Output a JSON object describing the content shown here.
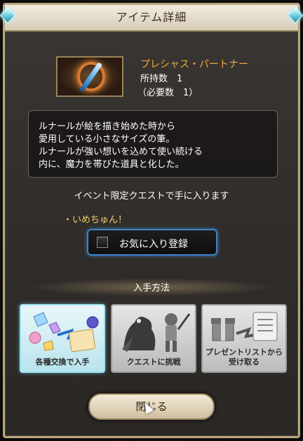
{
  "dialog": {
    "title": "アイテム詳細",
    "item_name": "プレシャス・パートナー",
    "owned_label": "所持数　1",
    "required_label": "（必要数　1）",
    "description": [
      "ルナールが絵を描き始めた時から",
      "愛用している小さなサイズの筆。",
      "ルナールが強い想いを込めて使い続ける",
      "内に、魔力を帯びた道具と化した。"
    ],
    "obtain_note": "イベント限定クエストで手に入ります",
    "event_name": "・いめちゅん！",
    "favorite_label": "お気に入り登録",
    "section_title": "入手方法",
    "methods": [
      {
        "label": "各種交換で入手"
      },
      {
        "label": "クエストに挑戦"
      },
      {
        "label_line1": "プレゼントリストから",
        "label_line2": "受け取る"
      }
    ],
    "close_label": "閉じる"
  },
  "colors": {
    "item_name": "#f0a640",
    "event_name": "#f2d26a",
    "frame_gold": "#b9a57d",
    "favorite_border": "#3c85c8"
  }
}
